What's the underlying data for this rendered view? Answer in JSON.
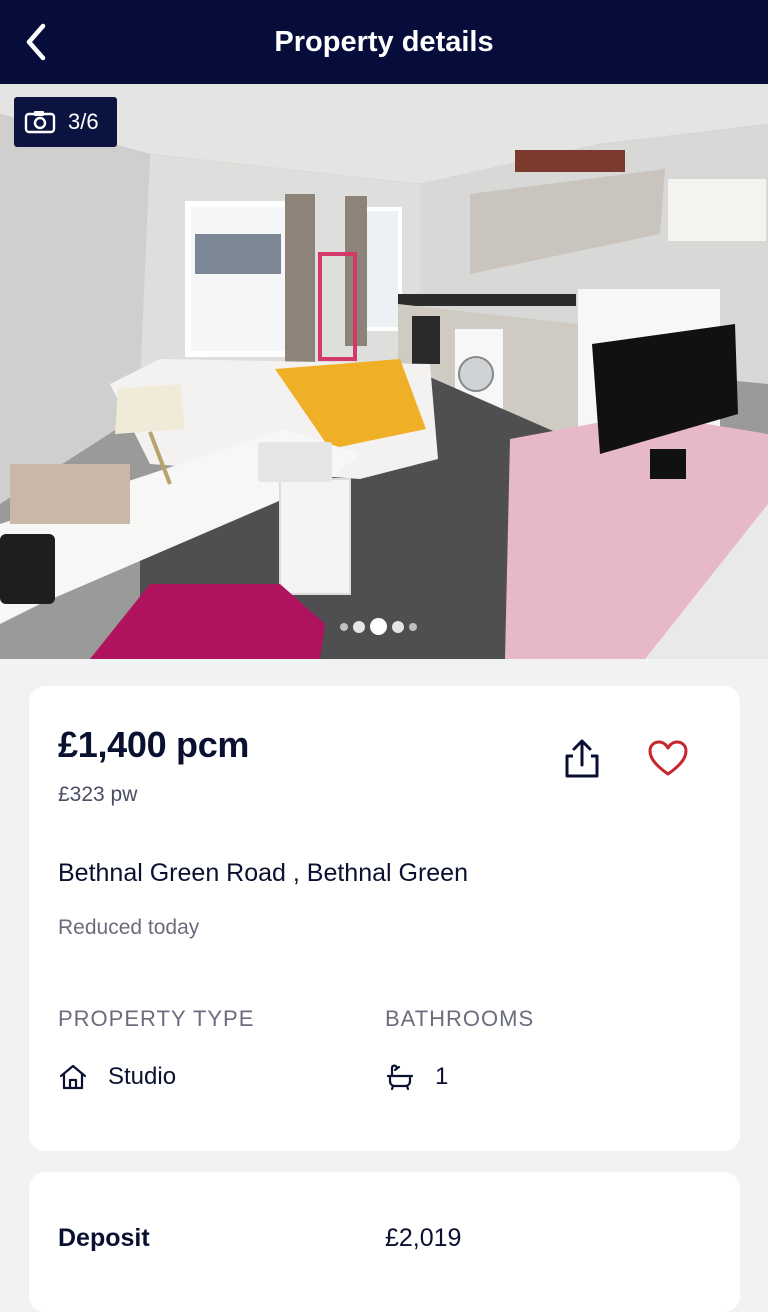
{
  "header": {
    "title": "Property details"
  },
  "gallery": {
    "counter": "3/6",
    "current_index": 3,
    "total": 6
  },
  "listing": {
    "price": "£1,400 pcm",
    "price_weekly": "£323 pw",
    "address": "Bethnal Green Road , Bethnal Green",
    "status": "Reduced today"
  },
  "details": {
    "property_type_label": "PROPERTY TYPE",
    "property_type_value": "Studio",
    "bathrooms_label": "BATHROOMS",
    "bathrooms_value": "1"
  },
  "deposit": {
    "label": "Deposit",
    "value": "£2,019"
  },
  "colors": {
    "header_bg": "#070d3a",
    "favourite": "#c4282e",
    "page_bg": "#f1f2f4"
  },
  "icons": [
    "back-arrow-icon",
    "camera-icon",
    "share-icon",
    "heart-icon",
    "house-icon",
    "bathtub-icon"
  ]
}
